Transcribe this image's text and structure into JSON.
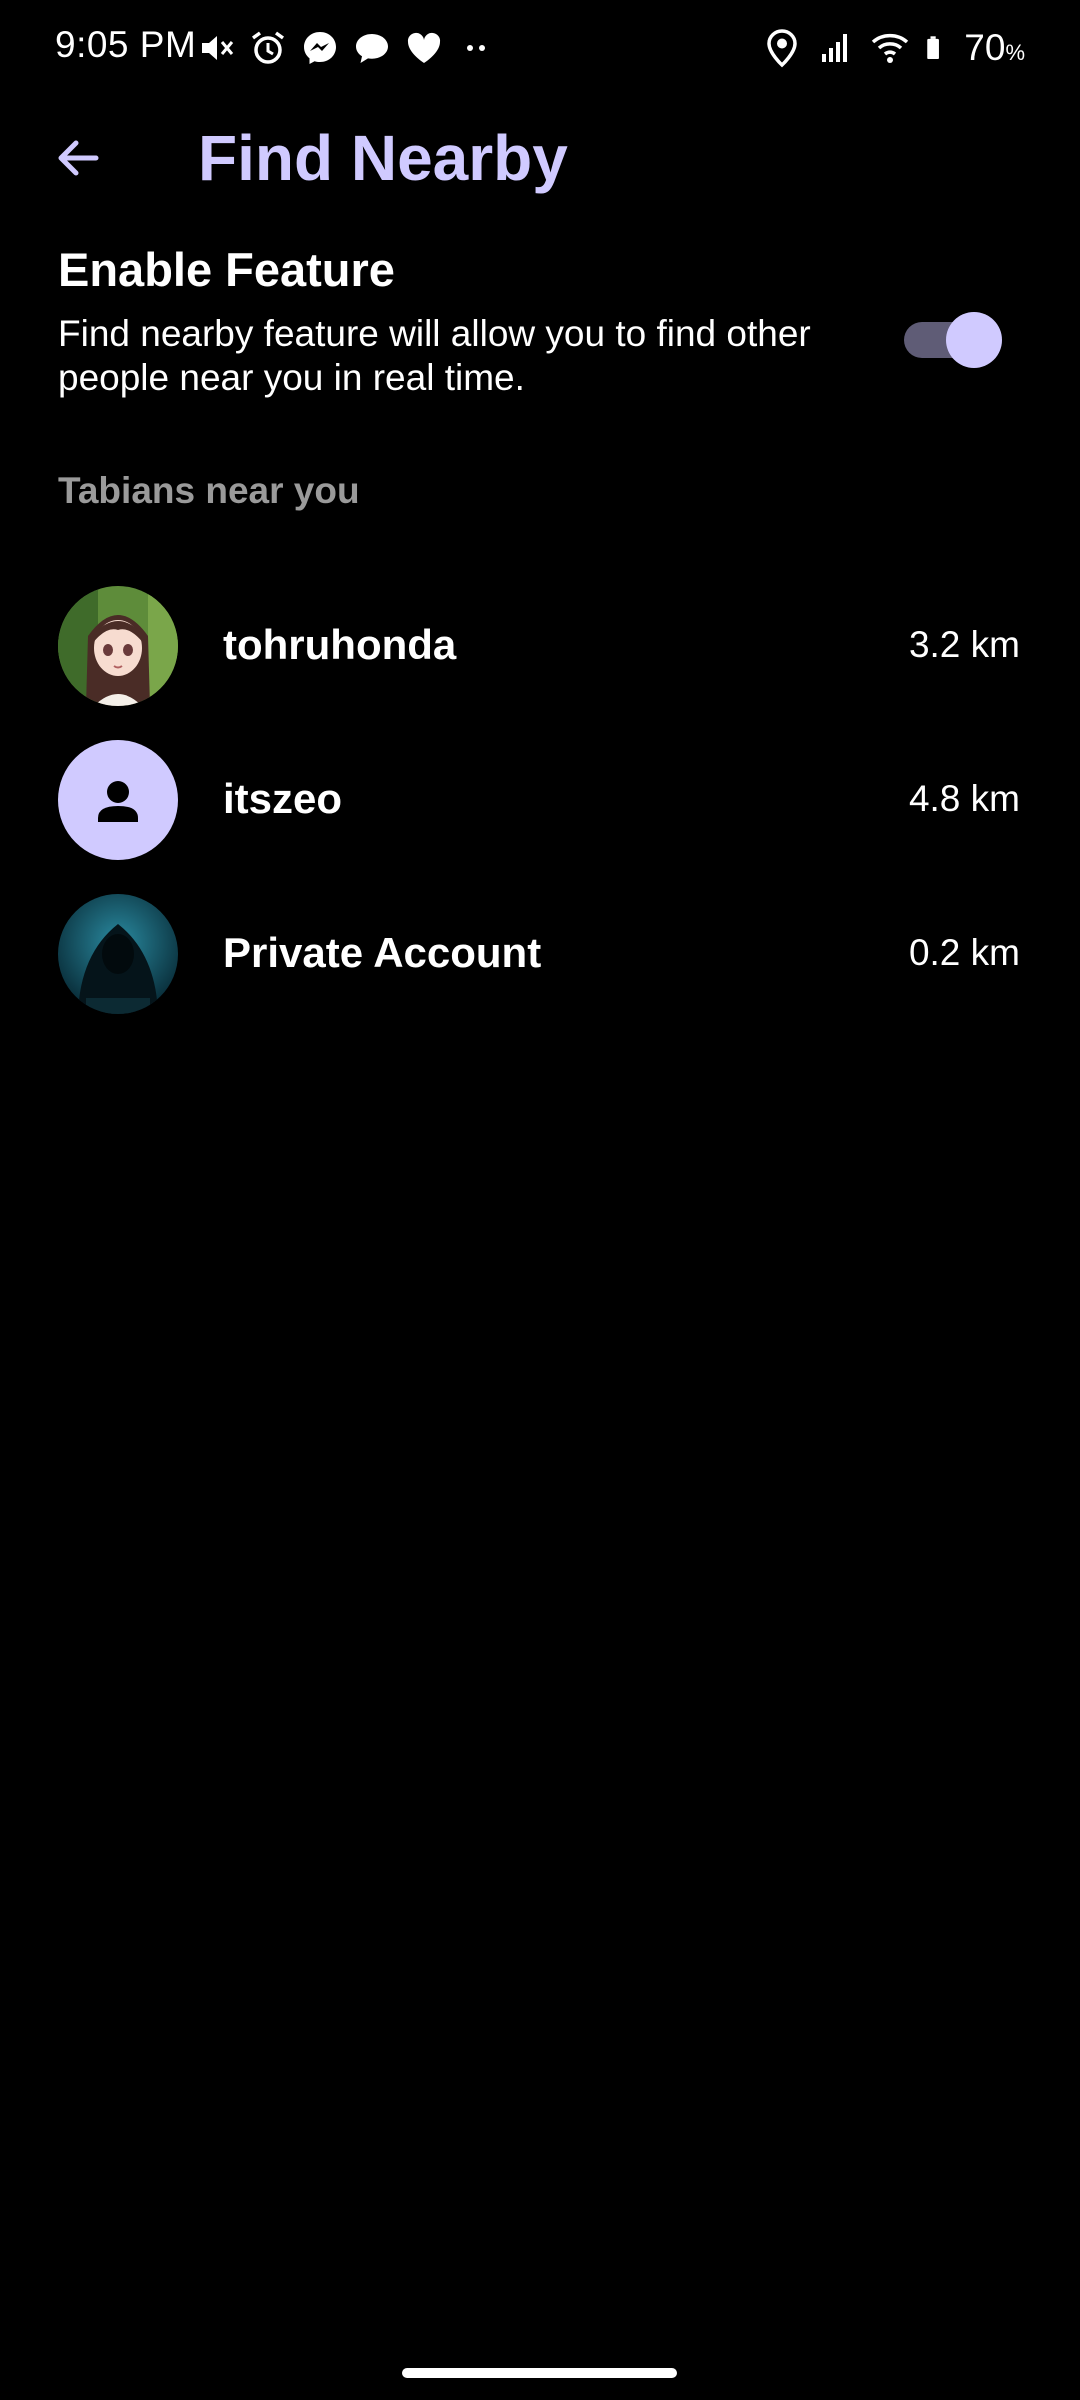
{
  "status_bar": {
    "time": "9:05 PM",
    "battery_percent": "70",
    "battery_suffix": "%",
    "left_icons": [
      "mute-icon",
      "alarm-icon",
      "messenger-icon",
      "chat-bubble-icon",
      "heart-icon",
      "more-dots-icon"
    ],
    "right_icons": [
      "location-icon",
      "signal-icon",
      "wifi-icon",
      "battery-icon"
    ]
  },
  "header": {
    "title": "Find Nearby",
    "back_icon": "arrow-left-icon"
  },
  "feature": {
    "title": "Enable Feature",
    "description": "Find nearby feature will allow you to find other people near you in real time.",
    "enabled": true
  },
  "nearby": {
    "section_title": "Tabians near you",
    "users": [
      {
        "name": "tohruhonda",
        "distance": "3.2 km",
        "avatar": "anime-girl-avatar"
      },
      {
        "name": "itszeo",
        "distance": "4.8 km",
        "avatar": "default-person-avatar"
      },
      {
        "name": "Private Account",
        "distance": "0.2 km",
        "avatar": "hooded-figure-avatar"
      }
    ]
  },
  "colors": {
    "accent": "#d0caff",
    "background": "#000000",
    "muted_text": "#9a9a9a",
    "toggle_track": "#5f5c76"
  }
}
